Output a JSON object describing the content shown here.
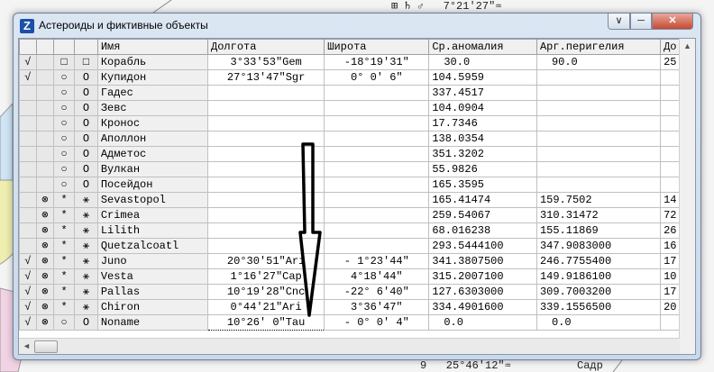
{
  "background": {
    "top_text": "⊞ ♄ ♂   7°21'27\"♒",
    "bottom_text_left": "9   25°46'12\"♒",
    "bottom_text_right": "Садр"
  },
  "window": {
    "title": "Астероиды и фиктивные объекты",
    "controls": {
      "menu": "∨",
      "minimize": "─",
      "close": "✕"
    }
  },
  "table": {
    "columns": [
      "",
      "",
      "",
      "",
      "Имя",
      "Долгота",
      "Широта",
      "Ср.аномалия",
      "Арг.перигелия",
      "До"
    ],
    "rows": [
      [
        "√",
        "",
        "□",
        "□",
        "Корабль",
        "3°33'53\"Gem",
        "-18°19'31\"",
        "30.0",
        "90.0",
        "25"
      ],
      [
        "√",
        "",
        "○",
        "O",
        "Купидон",
        "27°13'47\"Sgr",
        "0° 0' 6\"",
        "104.5959",
        "",
        ""
      ],
      [
        "",
        "",
        "○",
        "O",
        "Гадес",
        "",
        "",
        "337.4517",
        "",
        ""
      ],
      [
        "",
        "",
        "○",
        "O",
        "Зевс",
        "",
        "",
        "104.0904",
        "",
        ""
      ],
      [
        "",
        "",
        "○",
        "O",
        "Кронос",
        "",
        "",
        "17.7346",
        "",
        ""
      ],
      [
        "",
        "",
        "○",
        "O",
        "Аполлон",
        "",
        "",
        "138.0354",
        "",
        ""
      ],
      [
        "",
        "",
        "○",
        "O",
        "Адметос",
        "",
        "",
        "351.3202",
        "",
        ""
      ],
      [
        "",
        "",
        "○",
        "O",
        "Вулкан",
        "",
        "",
        "55.9826",
        "",
        ""
      ],
      [
        "",
        "",
        "○",
        "O",
        "Посейдон",
        "",
        "",
        "165.3595",
        "",
        ""
      ],
      [
        "",
        "⊗",
        "*",
        "⚹",
        "Sevastopol",
        "",
        "",
        "165.41474",
        "159.7502",
        "14"
      ],
      [
        "",
        "⊗",
        "*",
        "⚹",
        "Crimea",
        "",
        "",
        "259.54067",
        "310.31472",
        "72"
      ],
      [
        "",
        "⊗",
        "*",
        "⚹",
        "Lilith",
        "",
        "",
        "68.016238",
        "155.11869",
        "26"
      ],
      [
        "",
        "⊗",
        "*",
        "⚹",
        "Quetzalcoatl",
        "",
        "",
        "293.5444100",
        "347.9083000",
        "16"
      ],
      [
        "√",
        "⊗",
        "*",
        "⚹",
        "Juno",
        "20°30'51\"Ari",
        "- 1°23'44\"",
        "341.3807500",
        "246.7755400",
        "17"
      ],
      [
        "√",
        "⊗",
        "*",
        "⚹",
        "Vesta",
        "1°16'27\"Cap",
        "4°18'44\"",
        "315.2007100",
        "149.9186100",
        "10"
      ],
      [
        "√",
        "⊗",
        "*",
        "⚹",
        "Pallas",
        "10°19'28\"Cnc",
        "-22° 6'40\"",
        "127.6303000",
        "309.7003200",
        "17"
      ],
      [
        "√",
        "⊗",
        "*",
        "⚹",
        "Chiron",
        "0°44'21\"Ari",
        "3°36'47\"",
        "334.4901600",
        "339.1556500",
        "20"
      ],
      [
        "√",
        "⊗",
        "○",
        "O",
        "Noname",
        "10°26' 0\"Tau",
        "- 0° 0' 4\"",
        "0.0",
        "0.0",
        ""
      ]
    ],
    "editing_row": 17,
    "editing_col": 5
  },
  "scrollbars": {
    "left_arrow": "◄",
    "up_arrow": "▲"
  }
}
